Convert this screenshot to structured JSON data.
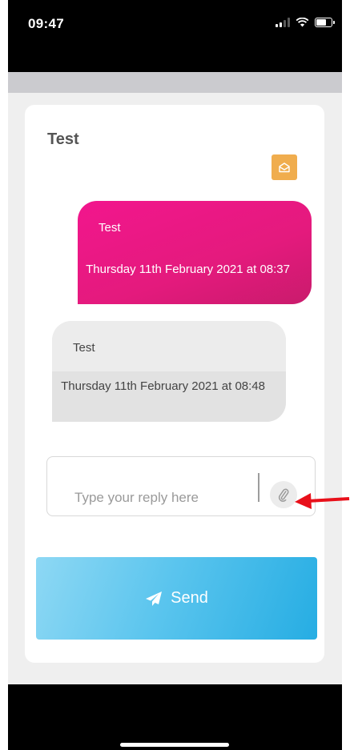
{
  "status_bar": {
    "time": "09:47"
  },
  "conversation": {
    "title": "Test",
    "messages": [
      {
        "direction": "sent",
        "text": "Test",
        "date": "Thursday 11th February 2021 at 08:37"
      },
      {
        "direction": "received",
        "text": "Test",
        "date": "Thursday 11th February 2021 at 08:48"
      }
    ]
  },
  "reply": {
    "placeholder": "Type your reply here",
    "value": ""
  },
  "send_button": {
    "label": "Send"
  },
  "icons": {
    "mail": "envelope-open-icon",
    "attach": "paperclip-icon",
    "send": "paper-plane-icon"
  },
  "colors": {
    "sent_bubble": "#e41a7d",
    "received_bubble": "#ececec",
    "mail_button": "#f0ad4e",
    "send_button": "#26ade3",
    "annotation_arrow": "#e8101a"
  }
}
